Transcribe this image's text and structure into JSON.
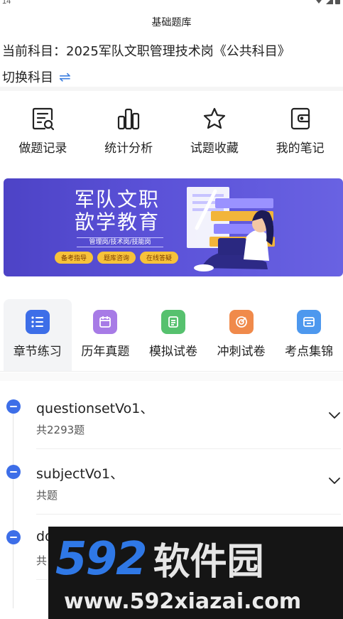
{
  "status_bar": {
    "time": "14"
  },
  "header": {
    "title": "基础题库"
  },
  "subject": {
    "current_text": "当前科目：2025军队文职管理技术岗《公共科目》",
    "switch_label": "切换科目"
  },
  "quick_actions": [
    {
      "label": "做题记录",
      "icon": "practice-record-icon"
    },
    {
      "label": "统计分析",
      "icon": "statistics-icon"
    },
    {
      "label": "试题收藏",
      "icon": "star-icon"
    },
    {
      "label": "我的笔记",
      "icon": "notebook-icon"
    }
  ],
  "banner": {
    "title_line1": "军队文职",
    "title_line2": "歆学教育",
    "subtitle": "管理岗/技术岗/技能岗",
    "pills": [
      "备考指导",
      "题库咨询",
      "在线答疑"
    ],
    "colors": {
      "background": "#5048cc",
      "pill": "#f7c23a"
    }
  },
  "tabs": [
    {
      "label": "章节练习",
      "icon": "list-icon",
      "color": "#3d6ee8",
      "active": true
    },
    {
      "label": "历年真题",
      "icon": "calendar-icon",
      "color": "#a77be6",
      "active": false
    },
    {
      "label": "模拟试卷",
      "icon": "document-icon",
      "color": "#56c16e",
      "active": false
    },
    {
      "label": "冲刺试卷",
      "icon": "target-icon",
      "color": "#f08a4b",
      "active": false
    },
    {
      "label": "考点集锦",
      "icon": "folder-icon",
      "color": "#4d98ee",
      "active": false
    }
  ],
  "chapters": [
    {
      "name": "questionsetVo1、",
      "count": "共2293题"
    },
    {
      "name": "subjectVo1、",
      "count": "共题"
    },
    {
      "name": "do",
      "count": "共"
    }
  ],
  "watermark": {
    "number": "592",
    "brand": "软件园",
    "url": "www.592xiazai.com"
  },
  "colors": {
    "accent": "#3d6ee8",
    "switch": "#3d7fe0"
  }
}
